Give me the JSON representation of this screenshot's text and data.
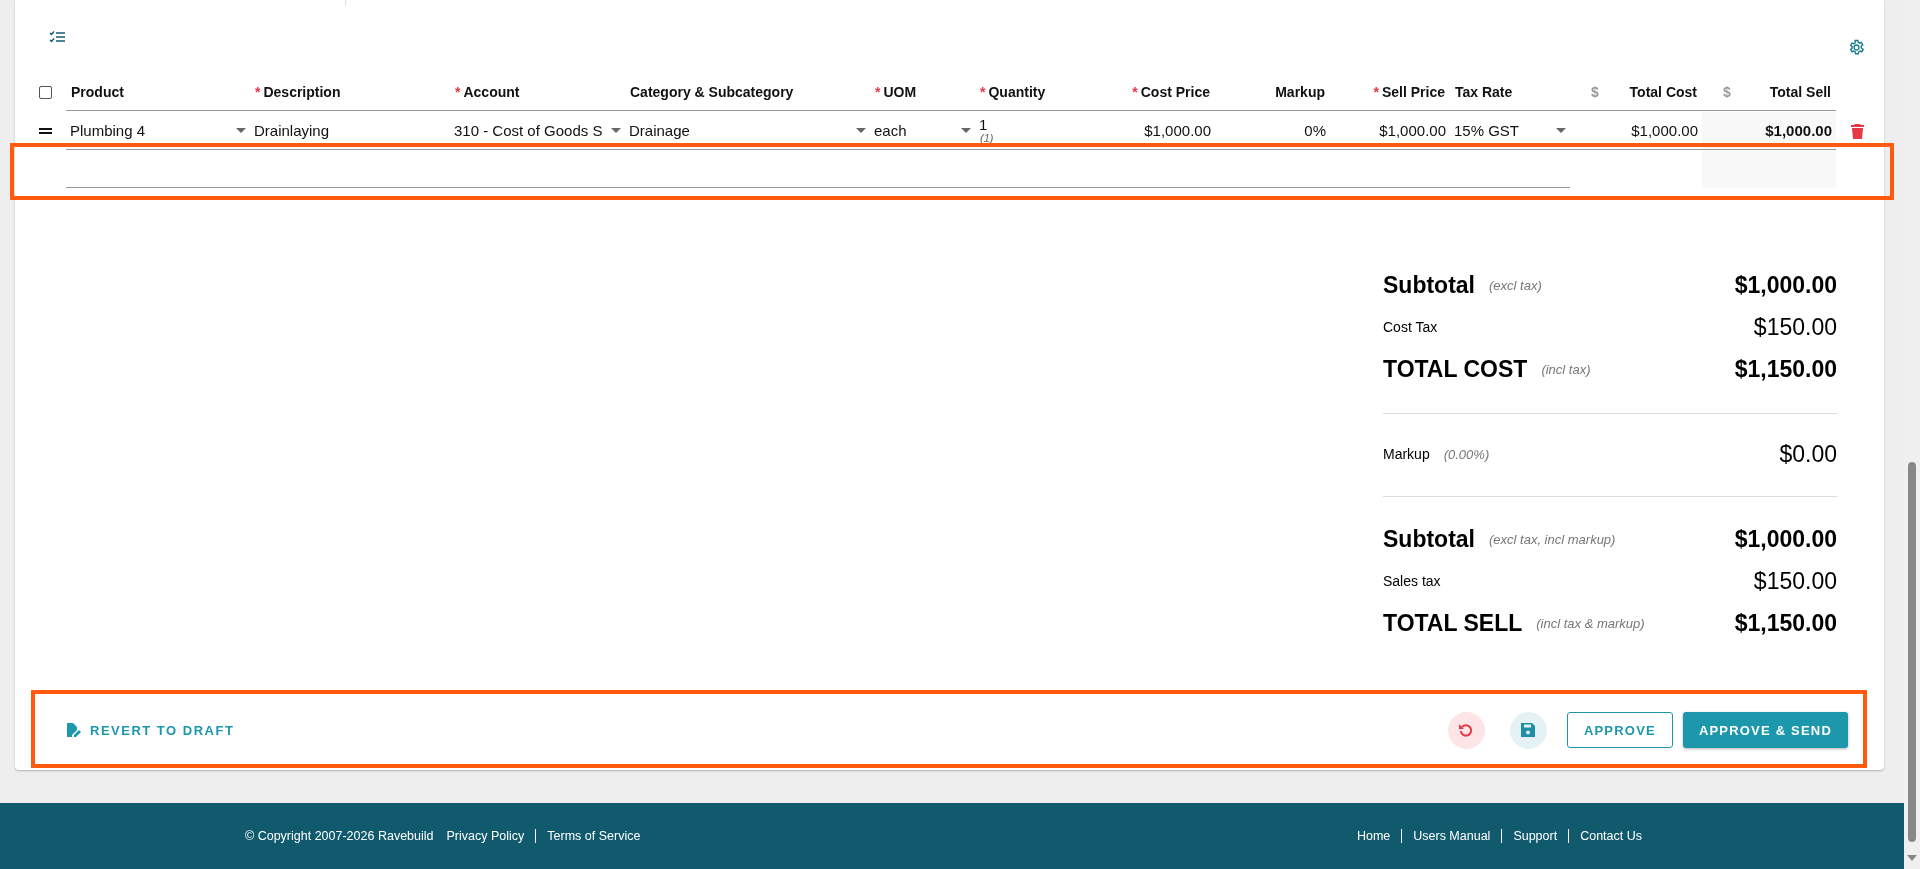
{
  "table": {
    "select_all": {
      "checked": false
    },
    "columns": [
      {
        "label": "Product"
      },
      {
        "label": "Description",
        "required_mark": "*"
      },
      {
        "label": "Account",
        "required_mark": "*"
      },
      {
        "label": "Category & Subcategory"
      },
      {
        "label": "UOM",
        "required_mark": "*"
      },
      {
        "label": "Quantity",
        "required_mark": "*"
      },
      {
        "label": "Cost Price",
        "required_mark": "*"
      },
      {
        "label": "Markup"
      },
      {
        "label": "Sell Price",
        "required_mark": "*"
      },
      {
        "label": "Tax Rate"
      },
      {
        "label": "Total Cost",
        "prefix": "$"
      },
      {
        "label": "Total Sell",
        "prefix": "$"
      }
    ],
    "rows": [
      {
        "cells": [
          {
            "kind": "select",
            "value": "Plumbing 4"
          },
          {
            "kind": "text",
            "value": "Drainlaying"
          },
          {
            "kind": "select",
            "value": "310 - Cost of Goods S"
          },
          {
            "kind": "select",
            "value": "Drainage"
          },
          {
            "kind": "select",
            "value": "each"
          },
          {
            "kind": "quantity",
            "value": "1",
            "note": "(1)"
          },
          {
            "kind": "number",
            "value": "$1,000.00"
          },
          {
            "kind": "number",
            "value": "0%"
          },
          {
            "kind": "number",
            "value": "$1,000.00"
          },
          {
            "kind": "select",
            "value": "15% GST"
          },
          {
            "kind": "number",
            "value": "$1,000.00"
          },
          {
            "kind": "total",
            "value": "$1,000.00"
          }
        ]
      }
    ]
  },
  "summary": [
    [
      {
        "kind": "major",
        "label": "Subtotal",
        "note": "(excl tax)",
        "value": "$1,000.00"
      },
      {
        "kind": "minor",
        "label": "Cost Tax",
        "value": "$150.00"
      },
      {
        "kind": "major",
        "label": "TOTAL COST",
        "note": "(incl tax)",
        "value": "$1,150.00"
      }
    ],
    [
      {
        "kind": "minor",
        "label": "Markup",
        "note": "(0.00%)",
        "value": "$0.00"
      }
    ],
    [
      {
        "kind": "major",
        "label": "Subtotal",
        "note": "(excl tax, incl markup)",
        "value": "$1,000.00"
      },
      {
        "kind": "minor",
        "label": "Sales tax",
        "value": "$150.00"
      },
      {
        "kind": "major",
        "label": "TOTAL SELL",
        "note": "(incl tax & markup)",
        "value": "$1,150.00"
      }
    ]
  ],
  "actions": {
    "revert": "REVERT TO DRAFT",
    "approve": "APPROVE",
    "approve_send": "APPROVE & SEND"
  },
  "footer": {
    "copyright": "© Copyright 2007-2026 Ravebuild",
    "left_links": [
      "Privacy Policy",
      "Terms of Service"
    ],
    "right_links": [
      "Home",
      "Users Manual",
      "Support",
      "Contact Us"
    ]
  }
}
